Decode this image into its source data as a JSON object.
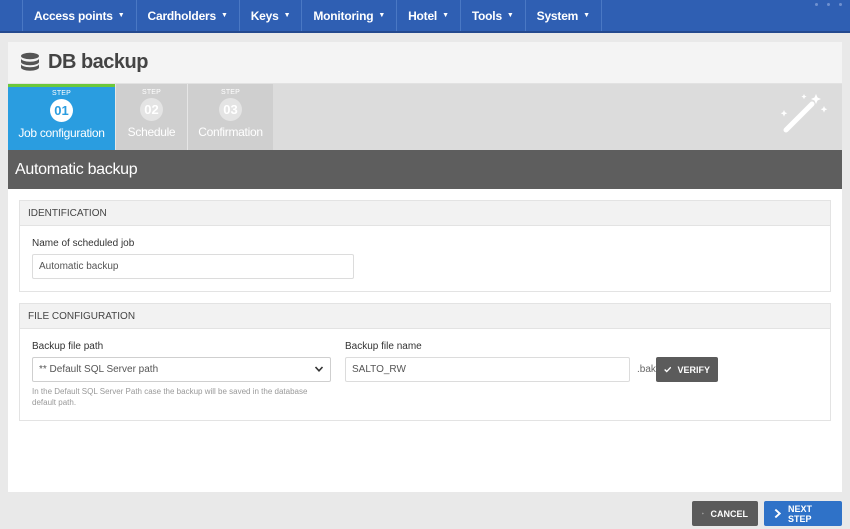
{
  "nav": {
    "items": [
      {
        "label": "Access points"
      },
      {
        "label": "Cardholders"
      },
      {
        "label": "Keys"
      },
      {
        "label": "Monitoring"
      },
      {
        "label": "Hotel"
      },
      {
        "label": "Tools"
      },
      {
        "label": "System"
      }
    ]
  },
  "page": {
    "title": "DB backup",
    "icon": "database-icon"
  },
  "steps": [
    {
      "tag": "STEP",
      "num": "01",
      "name": "Job configuration",
      "active": true
    },
    {
      "tag": "STEP",
      "num": "02",
      "name": "Schedule",
      "active": false
    },
    {
      "tag": "STEP",
      "num": "03",
      "name": "Confirmation",
      "active": false
    }
  ],
  "section": {
    "title": "Automatic backup"
  },
  "identification": {
    "heading": "IDENTIFICATION",
    "job_name_label": "Name of scheduled job",
    "job_name_value": "Automatic backup"
  },
  "file_config": {
    "heading": "FILE CONFIGURATION",
    "path_label": "Backup file path",
    "path_value": "** Default SQL Server path",
    "path_help": "In the Default SQL Server Path case the backup will be saved in the database default path.",
    "name_label": "Backup file name",
    "name_value": "SALTO_RW",
    "extension": ".bak",
    "verify_label": "VERIFY"
  },
  "footer": {
    "cancel_label": "CANCEL",
    "next_label": "NEXT STEP"
  },
  "colors": {
    "nav_bg": "#2f5fb3",
    "step_active": "#2a9de0",
    "step_active_top": "#6cc83a",
    "section_bar": "#5e5e5e",
    "next_button": "#2f72c8"
  }
}
